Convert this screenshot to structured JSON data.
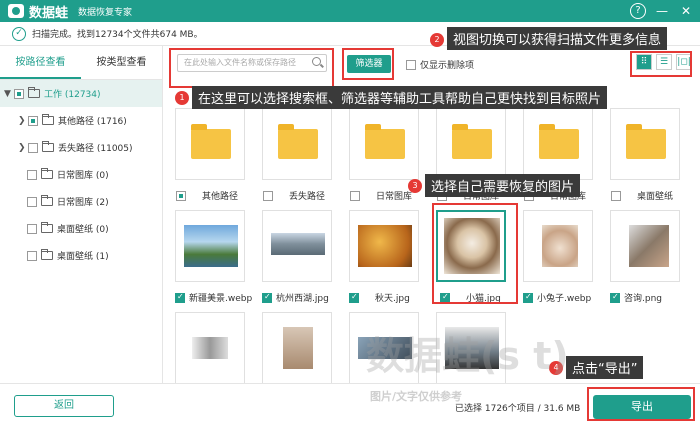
{
  "title": {
    "app_name": "数据蛙",
    "subtitle": "数据恢复专家"
  },
  "window": {
    "help": "?",
    "minimize": "—",
    "close": "✕"
  },
  "status": {
    "text": "扫描完成。找到12734个文件共674 MB。"
  },
  "tabs": [
    "按路径查看",
    "按类型查看"
  ],
  "tree": [
    {
      "caret": "▼",
      "label": "工作 (12734)"
    },
    {
      "caret": "❯",
      "label": "其他路径 (1716)"
    },
    {
      "caret": "❯",
      "label": "丢失路径 (11005)"
    },
    {
      "caret": "",
      "label": "日常图库 (0)"
    },
    {
      "caret": "",
      "label": "日常图库 (2)"
    },
    {
      "caret": "",
      "label": "桌面壁纸 (0)"
    },
    {
      "caret": "",
      "label": "桌面壁纸 (1)"
    }
  ],
  "toolbar": {
    "search_placeholder": "在此处输入文件名称或保存路径",
    "filter_label": "筛选器",
    "deleted_only_label": "仅显示删除项"
  },
  "view_buttons": [
    "⠿",
    "☰",
    "|◻|"
  ],
  "callouts": {
    "c1": "在这里可以选择搜索框、筛选器等辅助工具帮助自己更快找到目标照片",
    "c2": "视图切换可以获得扫描文件更多信息",
    "c3": "选择自己需要恢复的图片",
    "c4": "点击“导出”"
  },
  "callout_numbers": [
    "1",
    "2",
    "3",
    "4"
  ],
  "folders": [
    "其他路径",
    "丢失路径",
    "日常图库",
    "日常图库",
    "日常图库",
    "桌面壁纸"
  ],
  "images": [
    "新疆美景.webp",
    "杭州西湖.jpg",
    "秋天.jpg",
    "小猫.jpg",
    "小兔子.webp",
    "咨询.png"
  ],
  "bottom": {
    "back_label": "返回",
    "selected_text": "已选择 1726个项目 / 31.6 MB",
    "export_label": "导出"
  },
  "watermark": {
    "main": "数据蛙(s            t)",
    "sub": "图片/文字仅供参考"
  },
  "colors": {
    "accent": "#1f9e8c",
    "callout": "#e53935"
  }
}
